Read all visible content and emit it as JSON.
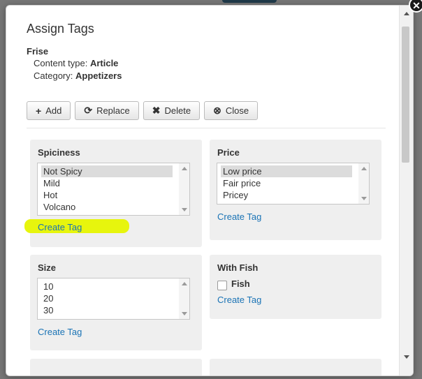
{
  "dialog": {
    "title": "Assign Tags",
    "node_title": "Frise",
    "content_type_label": "Content type:",
    "content_type_value": "Article",
    "category_label": "Category:",
    "category_value": "Appetizers",
    "close_icon": "close-x-icon"
  },
  "toolbar": {
    "add_label": "Add",
    "add_icon": "+",
    "replace_label": "Replace",
    "replace_icon": "⟳",
    "delete_label": "Delete",
    "delete_icon": "✖",
    "close_label": "Close",
    "close_icon": "⊗"
  },
  "groups": {
    "spiciness": {
      "label": "Spiciness",
      "options": [
        "Not Spicy",
        "Mild",
        "Hot",
        "Volcano"
      ],
      "selected": "Not Spicy",
      "create_link": "Create Tag"
    },
    "price": {
      "label": "Price",
      "options": [
        "Low price",
        "Fair price",
        "Pricey"
      ],
      "selected": "Low price",
      "create_link": "Create Tag"
    },
    "size": {
      "label": "Size",
      "options": [
        "10",
        "20",
        "30"
      ],
      "create_link": "Create Tag"
    },
    "with_fish": {
      "label": "With Fish",
      "checkbox_label": "Fish",
      "checked": false,
      "create_link": "Create Tag"
    }
  },
  "colors": {
    "link": "#1a73b5",
    "highlight": "#e6f400",
    "group_bg": "#efefef"
  }
}
